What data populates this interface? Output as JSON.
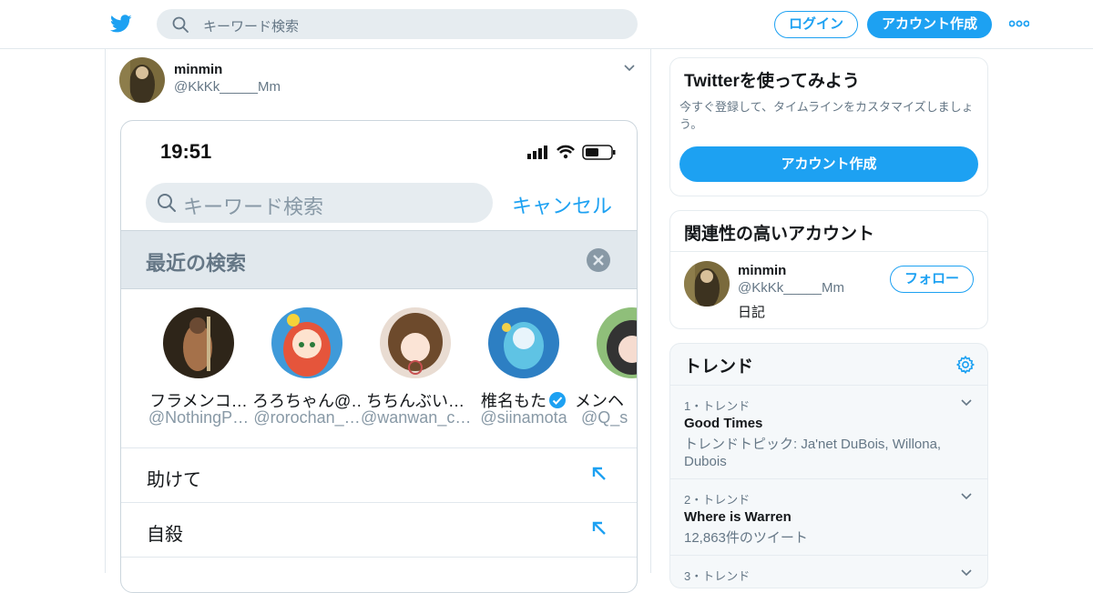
{
  "colors": {
    "accent": "#1da1f2",
    "text": "#14171a",
    "muted": "#657786",
    "border": "#e1e8ed"
  },
  "header": {
    "logo_icon": "twitter-bird-icon",
    "search_placeholder": "キーワード検索",
    "login_label": "ログイン",
    "signup_label": "アカウント作成",
    "more_icon": "more-dots-icon"
  },
  "tweet": {
    "author_name": "minmin",
    "author_handle": "@KkKk_____Mm",
    "menu_icon": "chevron-down-icon",
    "media": {
      "time": "19:51",
      "search_placeholder": "キーワード検索",
      "cancel_label": "キャンセル",
      "recent_title": "最近の検索",
      "recent_users": [
        {
          "name": "フラメンコ…",
          "handle": "@NothingP…"
        },
        {
          "name": "ろろちゃん@…",
          "handle": "@rorochan_…"
        },
        {
          "name": "ちちんぶい…",
          "handle": "@wanwan_c…"
        },
        {
          "name": "椎名もた",
          "handle": "@siinamota",
          "verified": true
        },
        {
          "name": "メンヘ",
          "handle": "@Q_s"
        }
      ],
      "recent_queries": [
        "助けて",
        "自殺"
      ]
    }
  },
  "sidebar": {
    "signup_card": {
      "title": "Twitterを使ってみよう",
      "text": "今すぐ登録して、タイムラインをカスタマイズしましょう。",
      "button_label": "アカウント作成"
    },
    "related_card": {
      "title": "関連性の高いアカウント",
      "account": {
        "name": "minmin",
        "handle": "@KkKk_____Mm",
        "bio": "日記",
        "follow_label": "フォロー"
      }
    },
    "trends_card": {
      "title": "トレンド",
      "settings_icon": "gear-icon",
      "items": [
        {
          "meta": "1・トレンド",
          "name": "Good Times",
          "desc": "トレンドトピック: Ja'net DuBois, Willona, Dubois"
        },
        {
          "meta": "2・トレンド",
          "name": "Where is Warren",
          "desc": "12,863件のツイート"
        },
        {
          "meta": "3・トレンド",
          "name": "",
          "desc": ""
        }
      ]
    }
  }
}
